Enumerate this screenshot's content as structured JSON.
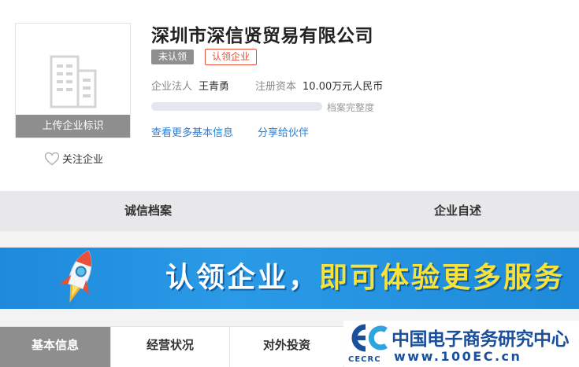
{
  "company": {
    "name": "深圳市深信贤贸易有限公司",
    "badge_unclaimed": "未认领",
    "badge_claim": "认领企业",
    "legal_person_label": "企业法人",
    "legal_person_value": "王青勇",
    "capital_label": "注册资本",
    "capital_value": "10.00万元人民币",
    "completeness_label": "档案完整度",
    "completeness_fraction": 0.0,
    "more_info_link": "查看更多基本信息",
    "share_link": "分享给伙伴"
  },
  "logo": {
    "upload_label": "上传企业标识",
    "follow_label": "关注企业",
    "icon": "building-icon"
  },
  "tabs": [
    "诚信档案",
    "企业自述"
  ],
  "banner": {
    "text_white": "认领企业，",
    "text_yellow": "即可体验更多服务"
  },
  "bottom_tabs": [
    "基本信息",
    "经营状况",
    "对外投资"
  ],
  "watermark": {
    "cn": "中国电子商务研究中心",
    "url": "www.100EC.cn",
    "abbr": "CECRC"
  },
  "colors": {
    "accent_blue": "#2b7ed3",
    "claim_red": "#e8503a",
    "banner_yellow": "#f7e23b",
    "tab_active_grey": "#8e8e8e"
  }
}
